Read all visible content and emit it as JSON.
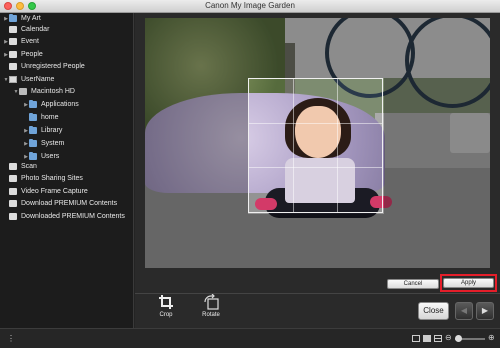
{
  "window": {
    "title": "Canon My Image Garden"
  },
  "sidebar": {
    "items": [
      {
        "label": "My Art",
        "arrow": "▶",
        "icon": "folder-icon"
      },
      {
        "label": "Calendar",
        "arrow": "",
        "icon": "calendar-icon"
      },
      {
        "label": "Event",
        "arrow": "▶",
        "icon": "event-icon"
      },
      {
        "label": "People",
        "arrow": "▶",
        "icon": "people-icon"
      },
      {
        "label": "Unregistered People",
        "arrow": "",
        "icon": "unregistered-people-icon"
      },
      {
        "label": "UserName",
        "arrow": "▼",
        "icon": "computer-icon"
      },
      {
        "label": "Macintosh HD",
        "arrow": "▼",
        "icon": "disk-icon"
      },
      {
        "label": "Applications",
        "arrow": "▶",
        "icon": "folder-icon"
      },
      {
        "label": "home",
        "arrow": "",
        "icon": "folder-icon"
      },
      {
        "label": "Library",
        "arrow": "▶",
        "icon": "folder-icon"
      },
      {
        "label": "System",
        "arrow": "▶",
        "icon": "folder-icon"
      },
      {
        "label": "Users",
        "arrow": "▶",
        "icon": "folder-icon"
      },
      {
        "label": "Scan",
        "arrow": "",
        "icon": "scan-icon"
      },
      {
        "label": "Photo Sharing Sites",
        "arrow": "",
        "icon": "photo-sharing-icon"
      },
      {
        "label": "Video Frame Capture",
        "arrow": "",
        "icon": "video-capture-icon"
      },
      {
        "label": "Download PREMIUM Contents",
        "arrow": "",
        "icon": "download-icon"
      },
      {
        "label": "Downloaded PREMIUM Contents",
        "arrow": "",
        "icon": "downloaded-icon"
      }
    ]
  },
  "editor": {
    "cancel_label": "Cancel",
    "apply_label": "Apply",
    "tools": [
      {
        "label": "Crop",
        "icon": "crop-icon"
      },
      {
        "label": "Rotate",
        "icon": "rotate-icon"
      }
    ],
    "close_label": "Close",
    "prev_icon": "◀",
    "next_icon": "▶"
  },
  "statusbar": {
    "info_icon": "⋮",
    "minus": "⊖",
    "plus": "⊕",
    "zoom_level": 0.0
  },
  "colors": {
    "highlight": "#e51e2a",
    "folder": "#6fa3d8"
  }
}
